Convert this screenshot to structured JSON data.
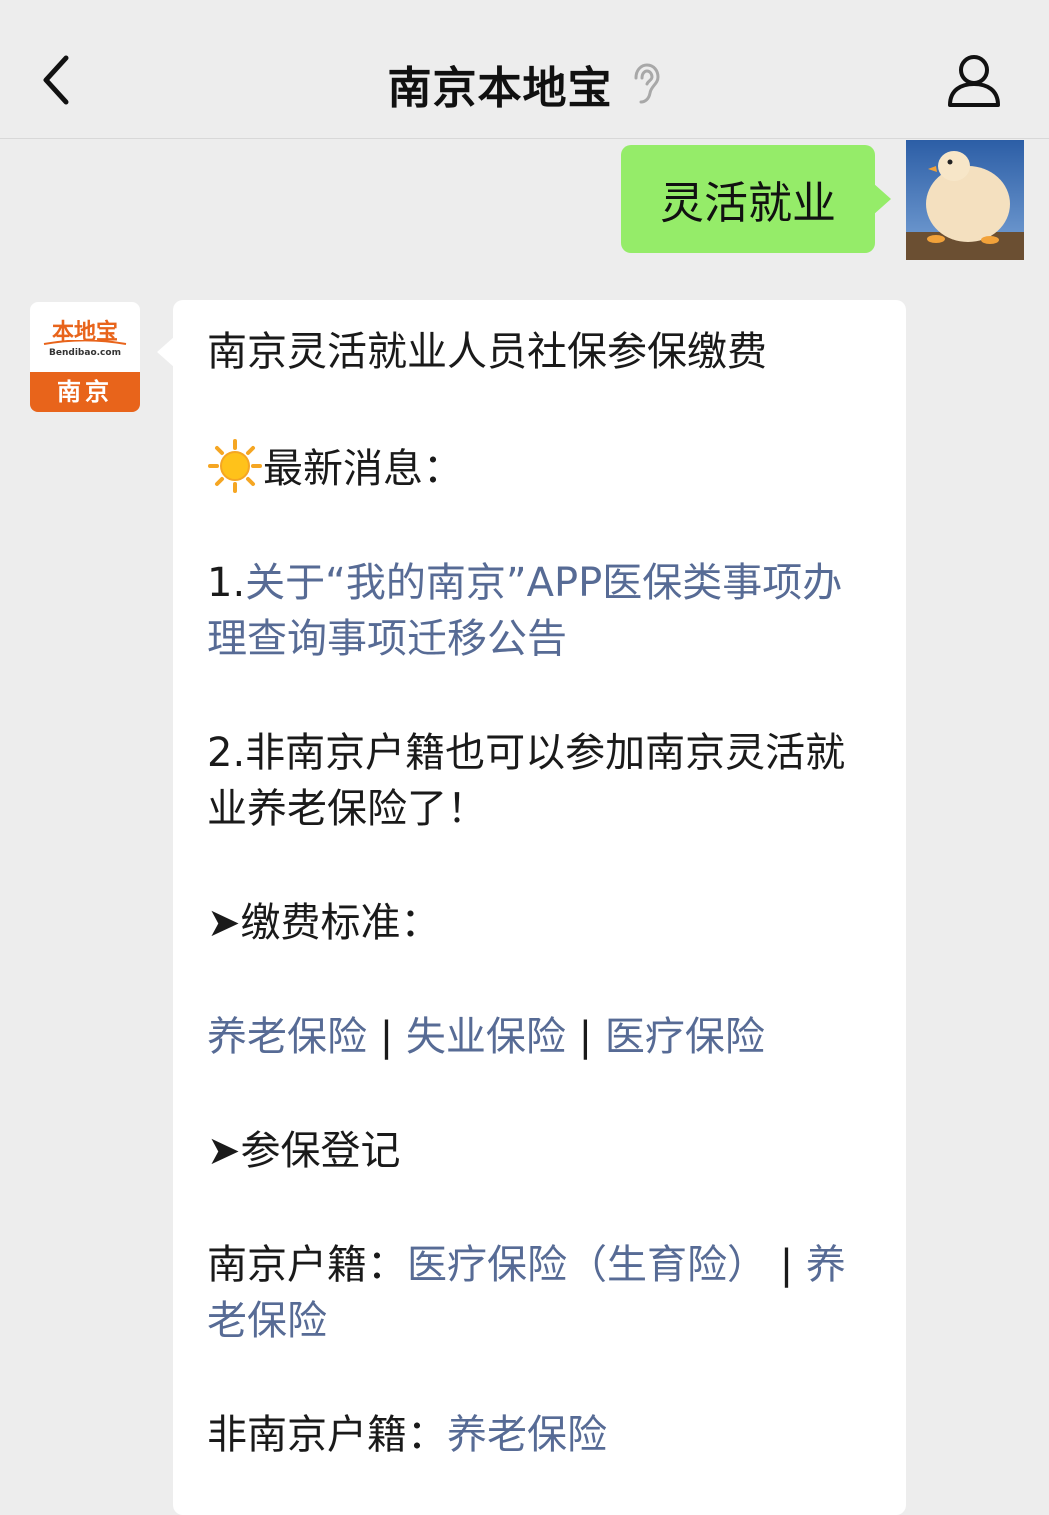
{
  "header": {
    "title": "南京本地宝",
    "back_icon": "chevron-left-icon",
    "ear_icon": "ear-icon",
    "profile_icon": "user-icon"
  },
  "sent_message": {
    "text": "灵活就业",
    "bubble_color": "#95ec69"
  },
  "bot_avatar": {
    "logo_text": "本地宝",
    "domain_text": "Bendibao.com",
    "city_text": "南京",
    "brand_color": "#e8641b"
  },
  "reply": {
    "title": "南京灵活就业人员社保参保缴费",
    "news_heading": "最新消息：",
    "news": [
      {
        "prefix": "1.",
        "text": "关于“我的南京”APP医保类事项办理查询事项迁移公告"
      },
      {
        "prefix": "2.",
        "text": "非南京户籍也可以参加南京灵活就业养老保险了！"
      }
    ],
    "fee_heading": "➤缴费标准：",
    "fee_links": [
      "养老保险",
      "失业保险",
      "医疗保险"
    ],
    "separator": "|",
    "register_heading": "➤参保登记",
    "nj_label": "南京户籍：",
    "nj_links": [
      "医疗保险（生育险）",
      "养老保险"
    ],
    "non_nj_label": "非南京户籍：",
    "non_nj_links": [
      "养老保险"
    ],
    "link_color": "#576b95"
  }
}
